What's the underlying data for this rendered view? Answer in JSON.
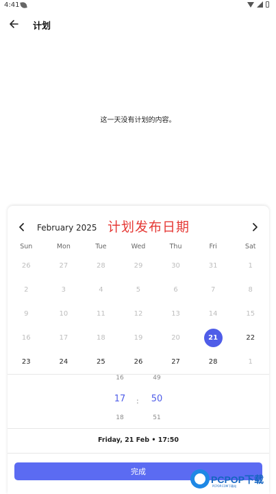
{
  "status_bar": {
    "time": "4:41"
  },
  "app_bar": {
    "title": "计划"
  },
  "empty_message": "这一天没有计划的内容。",
  "calendar": {
    "month_label": "February 2025",
    "overlay_caption": "计划发布日期",
    "weekdays": [
      "Sun",
      "Mon",
      "Tue",
      "Wed",
      "Thu",
      "Fri",
      "Sat"
    ],
    "days": [
      {
        "label": "26",
        "state": "muted"
      },
      {
        "label": "27",
        "state": "muted"
      },
      {
        "label": "28",
        "state": "muted"
      },
      {
        "label": "29",
        "state": "muted"
      },
      {
        "label": "30",
        "state": "muted"
      },
      {
        "label": "31",
        "state": "muted"
      },
      {
        "label": "1",
        "state": "muted"
      },
      {
        "label": "2",
        "state": "muted"
      },
      {
        "label": "3",
        "state": "muted"
      },
      {
        "label": "4",
        "state": "muted"
      },
      {
        "label": "5",
        "state": "muted"
      },
      {
        "label": "6",
        "state": "muted"
      },
      {
        "label": "7",
        "state": "muted"
      },
      {
        "label": "8",
        "state": "muted"
      },
      {
        "label": "9",
        "state": "muted"
      },
      {
        "label": "10",
        "state": "muted"
      },
      {
        "label": "11",
        "state": "muted"
      },
      {
        "label": "12",
        "state": "muted"
      },
      {
        "label": "13",
        "state": "muted"
      },
      {
        "label": "14",
        "state": "muted"
      },
      {
        "label": "15",
        "state": "muted"
      },
      {
        "label": "16",
        "state": "muted"
      },
      {
        "label": "17",
        "state": "muted"
      },
      {
        "label": "18",
        "state": "muted"
      },
      {
        "label": "19",
        "state": "muted"
      },
      {
        "label": "20",
        "state": "muted"
      },
      {
        "label": "21",
        "state": "selected"
      },
      {
        "label": "22",
        "state": "active"
      },
      {
        "label": "23",
        "state": "active"
      },
      {
        "label": "24",
        "state": "active"
      },
      {
        "label": "25",
        "state": "active"
      },
      {
        "label": "26",
        "state": "active"
      },
      {
        "label": "27",
        "state": "active"
      },
      {
        "label": "28",
        "state": "active"
      },
      {
        "label": "1",
        "state": "muted"
      }
    ]
  },
  "time_picker": {
    "hour_prev": "16",
    "hour": "17",
    "hour_next": "18",
    "separator": ":",
    "minute_prev": "49",
    "minute": "50",
    "minute_next": "51"
  },
  "summary": "Friday, 21 Feb  •  17:50",
  "done_label": "完成",
  "watermark": {
    "brand": "PCPOP下载",
    "sub": "PCPOP.COM下载站"
  },
  "colors": {
    "accent": "#4f5de8",
    "button": "#5b6bf2",
    "caption": "#e53935"
  }
}
